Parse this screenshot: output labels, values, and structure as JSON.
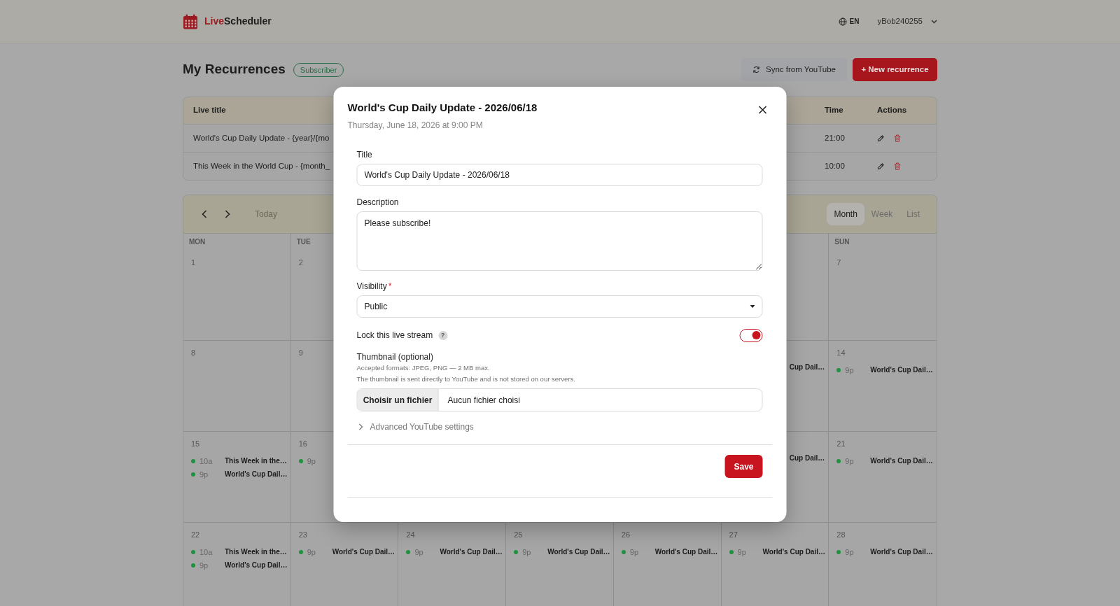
{
  "header": {
    "logo": {
      "accent": "Live",
      "rest": "Scheduler"
    },
    "language": "EN",
    "user": "yBob240255"
  },
  "page": {
    "title": "My Recurrences",
    "plan": "Subscriber",
    "buttons": [
      {
        "kind": "sync",
        "label": "Sync from YouTube"
      },
      {
        "kind": "create",
        "label": "+ New recurrence"
      }
    ]
  },
  "recurrences": {
    "columns": [
      "Live title",
      "Time",
      "Actions"
    ],
    "rows": [
      {
        "title": "World's Cup Daily Update - {year}/{mo",
        "time": "21:00"
      },
      {
        "title": "This Week in the World Cup - {month_",
        "time": "10:00"
      }
    ]
  },
  "calendar": {
    "today": {
      "label": "Today",
      "disabled": true
    },
    "views": [
      {
        "label": "Month",
        "selected": true
      },
      {
        "label": "Week",
        "selected": false
      },
      {
        "label": "List",
        "selected": false
      }
    ],
    "weekdays": {
      "mon": "MON",
      "tue": "TUE",
      "sun": "SUN"
    },
    "weeks": [
      {
        "mon": {
          "day": "1"
        },
        "tue": {
          "day": "2"
        },
        "sun": {
          "day": "7"
        }
      },
      {
        "mon": {
          "day": "8"
        },
        "tue": {
          "day": "9"
        },
        "sat": {
          "events": [
            {
              "title": "Cup Dail…"
            }
          ]
        },
        "sun": {
          "day": "14",
          "events": [
            {
              "time": "9p",
              "title": "World's Cup Dail…"
            }
          ]
        }
      },
      {
        "mon": {
          "day": "15",
          "events": [
            {
              "time": "10a",
              "title": "This Week in the…"
            },
            {
              "time": "9p",
              "title": "World's Cup Dail…"
            }
          ]
        },
        "tue": {
          "day": "16",
          "events": [
            {
              "time": "9p"
            }
          ]
        },
        "sat": {
          "events": [
            {
              "title": "Cup Dail…"
            }
          ]
        },
        "sun": {
          "day": "21",
          "events": [
            {
              "time": "9p",
              "title": "World's Cup Dail…"
            }
          ]
        }
      },
      {
        "mon": {
          "day": "22",
          "events": [
            {
              "time": "10a",
              "title": "This Week in the…"
            },
            {
              "time": "9p",
              "title": "World's Cup Dail…"
            }
          ]
        },
        "tue": {
          "day": "23",
          "events": [
            {
              "time": "9p",
              "title": "World's Cup Dail…"
            }
          ]
        },
        "wed": {
          "day": "24",
          "events": [
            {
              "time": "9p",
              "title": "World's Cup Dail…"
            }
          ]
        },
        "thu": {
          "day": "25",
          "events": [
            {
              "time": "9p",
              "title": "World's Cup Dail…"
            }
          ]
        },
        "fri": {
          "day": "26",
          "events": [
            {
              "time": "9p",
              "title": "World's Cup Dail…"
            }
          ]
        },
        "sat": {
          "day": "27",
          "events": [
            {
              "time": "9p",
              "title": "World's Cup Dail…"
            }
          ]
        },
        "sun": {
          "day": "28",
          "events": [
            {
              "time": "9p",
              "title": "World's Cup Dail…"
            }
          ]
        }
      }
    ]
  },
  "modal": {
    "title": "World's Cup Daily Update - 2026/06/18",
    "subtitle": "Thursday, June 18, 2026 at 9:00 PM",
    "fields": [
      {
        "kind": "text",
        "label": "Title",
        "value": "World's Cup Daily Update - 2026/06/18"
      },
      {
        "kind": "textarea",
        "label": "Description",
        "value": "Please subscribe!"
      },
      {
        "kind": "select",
        "label": "Visibility",
        "required_mark": "*",
        "value": "Public"
      },
      {
        "kind": "switch",
        "label": "Lock this live stream",
        "help": "?",
        "on": true
      },
      {
        "kind": "file",
        "label": "Thumbnail (optional)",
        "hints": [
          "Accepted formats: JPEG, PNG — 2 MB max.",
          "The thumbnail is sent directly to YouTube and is not stored on our servers."
        ],
        "button": "Choisir un fichier",
        "value": "Aucun fichier choisi"
      },
      {
        "kind": "disclosure",
        "label": "Advanced YouTube settings",
        "expanded": false
      }
    ],
    "save": "Save"
  }
}
